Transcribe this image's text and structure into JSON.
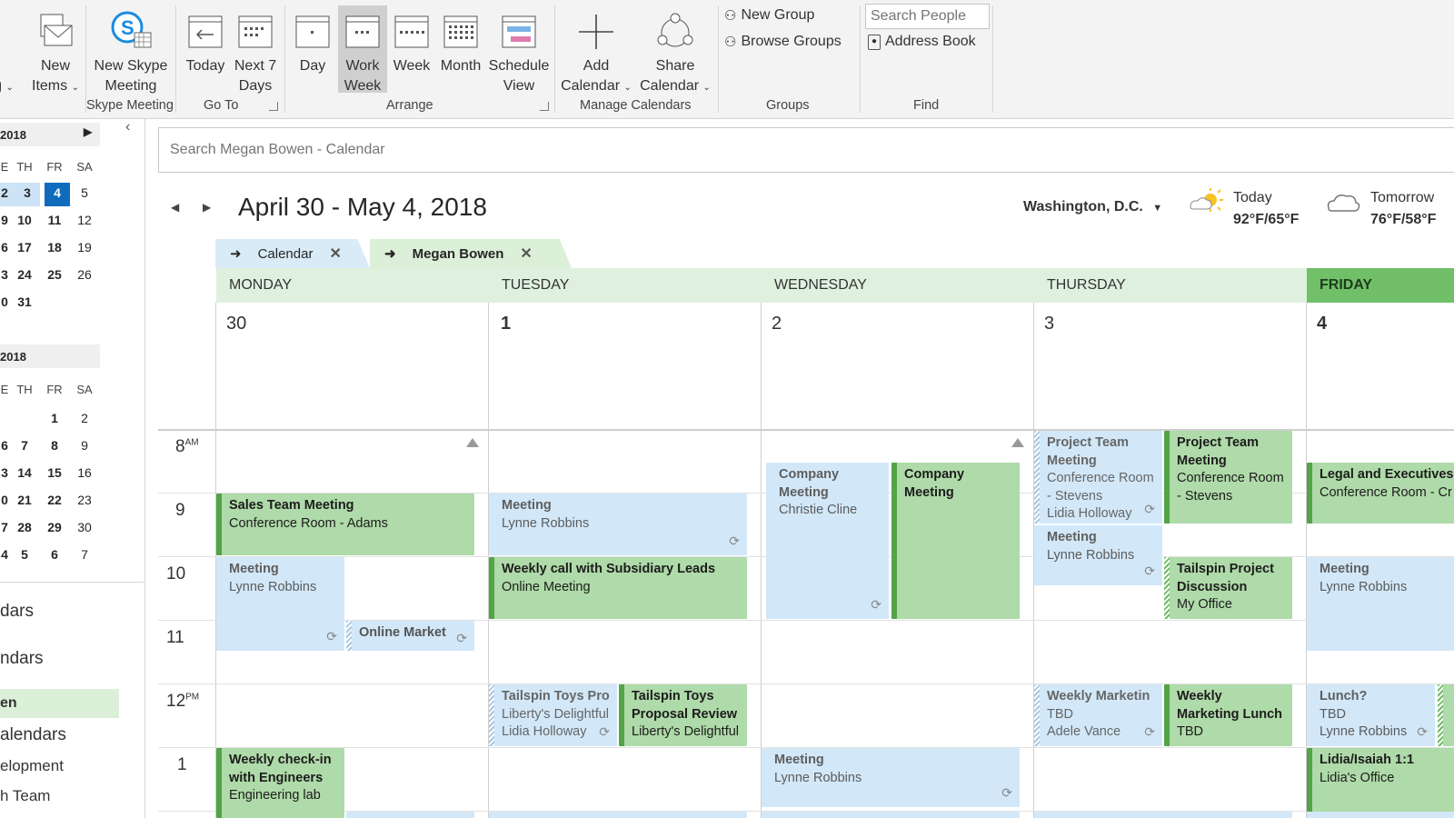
{
  "ribbon": {
    "cut_left": {
      "line1": "",
      "line2": "g"
    },
    "new_items": {
      "line1": "New",
      "line2": "Items"
    },
    "new_skype": {
      "line1": "New Skype",
      "line2": "Meeting"
    },
    "today": {
      "label": "Today"
    },
    "next7": {
      "line1": "Next 7",
      "line2": "Days"
    },
    "day": {
      "label": "Day"
    },
    "work_week": {
      "line1": "Work",
      "line2": "Week"
    },
    "week": {
      "label": "Week"
    },
    "month": {
      "label": "Month"
    },
    "schedule_view": {
      "line1": "Schedule",
      "line2": "View"
    },
    "add_calendar": {
      "line1": "Add",
      "line2": "Calendar"
    },
    "share_calendar": {
      "line1": "Share",
      "line2": "Calendar"
    },
    "new_group": "New Group",
    "browse_groups": "Browse Groups",
    "search_people_placeholder": "Search People",
    "address_book": "Address Book",
    "groups": {
      "skype": "Skype Meeting",
      "goto": "Go To",
      "arrange": "Arrange",
      "manage": "Manage Calendars",
      "groups": "Groups",
      "find": "Find"
    }
  },
  "nav": {
    "month1": {
      "title": "2018",
      "headers": [
        "E",
        "TH",
        "FR",
        "SA"
      ],
      "rows": [
        [
          "2",
          "3",
          "4",
          "5"
        ],
        [
          "9",
          "10",
          "11",
          "12"
        ],
        [
          "6",
          "17",
          "18",
          "19"
        ],
        [
          "3",
          "24",
          "25",
          "26"
        ],
        [
          "0",
          "31",
          "",
          ""
        ]
      ]
    },
    "month2": {
      "title": "2018",
      "headers": [
        "E",
        "TH",
        "FR",
        "SA"
      ],
      "rows": [
        [
          "",
          "",
          "1",
          "2"
        ],
        [
          "6",
          "7",
          "8",
          "9"
        ],
        [
          "3",
          "14",
          "15",
          "16"
        ],
        [
          "0",
          "21",
          "22",
          "23"
        ],
        [
          "7",
          "28",
          "29",
          "30"
        ],
        [
          "4",
          "5",
          "6",
          "7"
        ]
      ]
    },
    "items": [
      "dars",
      "ndars",
      "en",
      "alendars",
      "elopment",
      "h Team"
    ]
  },
  "search": {
    "placeholder": "Search Megan Bowen - Calendar"
  },
  "header": {
    "range": "April 30 - May 4, 2018",
    "location": "Washington, D.C.",
    "today_label": "Today",
    "today_temp": "92°F/65°F",
    "tomorrow_label": "Tomorrow",
    "tomorrow_temp": "76°F/58°F"
  },
  "tabs": [
    "Calendar",
    "Megan Bowen"
  ],
  "days": [
    {
      "name": "MONDAY",
      "num": "30"
    },
    {
      "name": "TUESDAY",
      "num": "1"
    },
    {
      "name": "WEDNESDAY",
      "num": "2"
    },
    {
      "name": "THURSDAY",
      "num": "3"
    },
    {
      "name": "FRIDAY",
      "num": "4"
    }
  ],
  "hours": [
    {
      "h": "8",
      "ampm": "AM"
    },
    {
      "h": "9",
      "ampm": ""
    },
    {
      "h": "10",
      "ampm": ""
    },
    {
      "h": "11",
      "ampm": ""
    },
    {
      "h": "12",
      "ampm": "PM"
    },
    {
      "h": "1",
      "ampm": ""
    }
  ],
  "events": {
    "mon_sales": {
      "title": "Sales Team Meeting",
      "l1": "Conference Room - Adams"
    },
    "mon_meeting": {
      "title": "Meeting",
      "l1": "Lynne Robbins"
    },
    "mon_online": {
      "title": "Online Market"
    },
    "mon_weekly": {
      "title": "Weekly check-in with Engineers",
      "l1": "Engineering lab"
    },
    "tue_meeting": {
      "title": "Meeting",
      "l1": "Lynne Robbins"
    },
    "tue_weekly": {
      "title": "Weekly call with Subsidiary Leads",
      "l1": "Online Meeting"
    },
    "tue_tail1": {
      "title": "Tailspin Toys Pro",
      "l1": "Liberty's Delightful",
      "l2": "Lidia Holloway"
    },
    "tue_tail2": {
      "title": "Tailspin Toys Proposal Review",
      "l1": "Liberty's Delightful"
    },
    "wed_co1": {
      "title": "Company Meeting",
      "l1": "Christie Cline"
    },
    "wed_co2": {
      "title": "Company Meeting"
    },
    "wed_meeting": {
      "title": "Meeting",
      "l1": "Lynne Robbins"
    },
    "thu_pt1": {
      "title": "Project Team Meeting",
      "l1": "Conference Room - Stevens",
      "l2": "Lidia Holloway"
    },
    "thu_pt2": {
      "title": "Project Team Meeting",
      "l1": "Conference Room - Stevens"
    },
    "thu_meeting": {
      "title": "Meeting",
      "l1": "Lynne Robbins"
    },
    "thu_tail": {
      "title": "Tailspin Project Discussion",
      "l1": "My Office"
    },
    "thu_wm1": {
      "title": "Weekly Marketin",
      "l1": "TBD",
      "l2": "Adele Vance"
    },
    "thu_wm2": {
      "title": "Weekly Marketing Lunch",
      "l1": "TBD"
    },
    "fri_legal": {
      "title": "Legal and Executives",
      "l1": "Conference Room - Cr"
    },
    "fri_meeting": {
      "title": "Meeting",
      "l1": "Lynne Robbins"
    },
    "fri_lunch": {
      "title": "Lunch?",
      "l1": "TBD",
      "l2": "Lynne Robbins"
    },
    "fri_lidia": {
      "title": "Lidia/Isaiah 1:1",
      "l1": "Lidia's Office"
    }
  },
  "colors": {
    "accent_blue": "#0f6cbd",
    "green_event": "#afdaa9",
    "blue_event": "#d2e8f9",
    "today_header": "#71c069"
  }
}
